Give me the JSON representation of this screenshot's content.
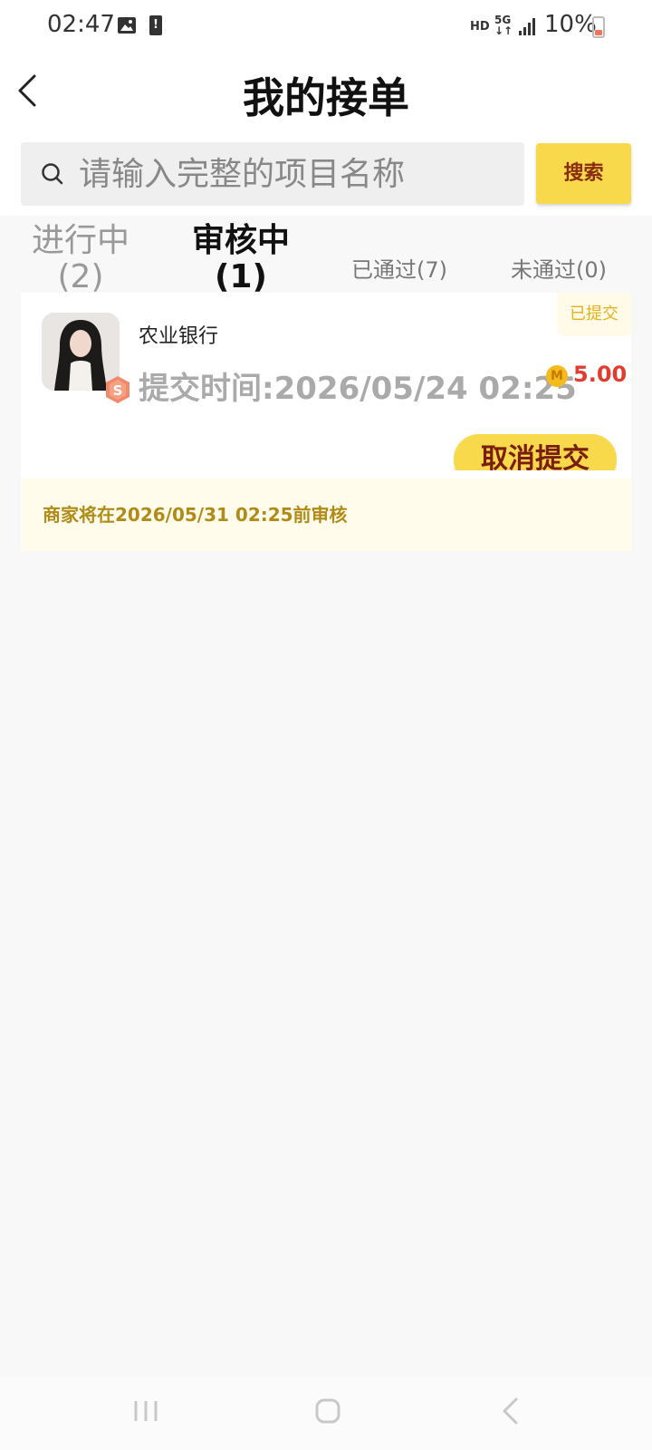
{
  "status_bar": {
    "time": "02:47",
    "hd": "HD",
    "network": "5G",
    "battery": "10%",
    "icons": [
      "image-icon",
      "alert-icon",
      "signal-icon",
      "battery-icon"
    ],
    "battery_level": 0.1
  },
  "header": {
    "title": "我的接单",
    "back_icon": "chevron-left-icon"
  },
  "search": {
    "placeholder": "请输入完整的项目名称",
    "button_label": "搜索",
    "icon": "search-icon"
  },
  "tabs": [
    {
      "label": "进行中(2)",
      "active": false
    },
    {
      "label": "审核中(1)",
      "active": true
    },
    {
      "label": "已通过(7)",
      "active": false
    },
    {
      "label": "未通过(0)",
      "active": false
    }
  ],
  "order": {
    "status_badge": "已提交",
    "project_name": "农业银行",
    "submit_time": "提交时间:2026/05/24 02:25",
    "reward": "5.00",
    "coin_label": "M",
    "level_label": "S",
    "cancel_label": "取消提交",
    "notice": "商家将在2026/05/31 02:25前审核"
  },
  "colors": {
    "accent": "#f8d94c",
    "accent_text": "#8a2c0d",
    "price": "#e23b2f",
    "notice_bg": "#fffcec",
    "notice_text": "#b08b18"
  }
}
